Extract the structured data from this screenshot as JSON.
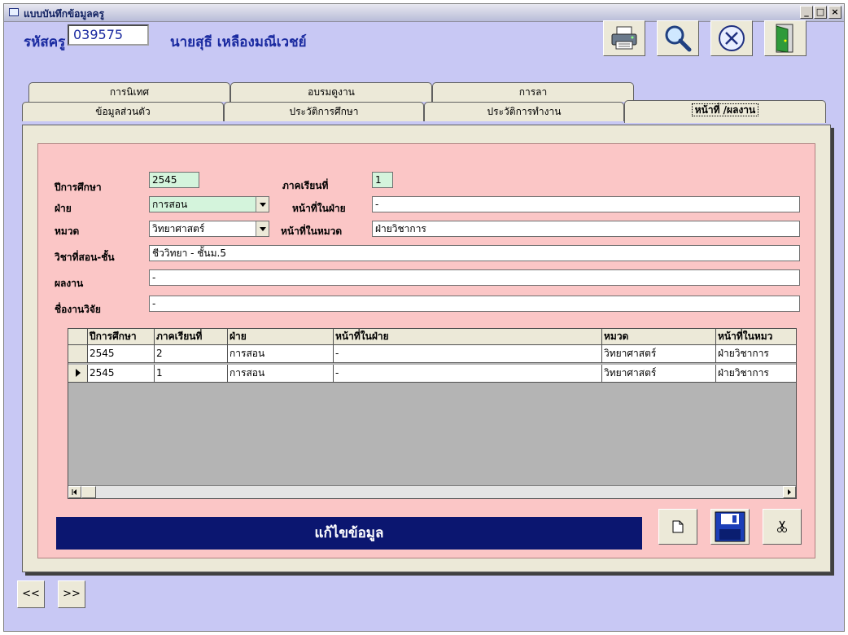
{
  "window": {
    "title": "แบบบันทึกข้อมูลครู"
  },
  "header": {
    "code_label": "รหัสครู",
    "code_value": "039575",
    "teacher_name": "นายสุธี เหลืองมณีเวชย์"
  },
  "tabs_back": [
    "การนิเทศ",
    "อบรมดูงาน",
    "การลา"
  ],
  "tabs_front": [
    "ข้อมูลส่วนตัว",
    "ประวัติการศึกษา",
    "ประวัติการทำงาน",
    "หน้าที่ /ผลงาน"
  ],
  "form": {
    "year_label": "ปีการศึกษา",
    "year_value": "2545",
    "term_label": "ภาคเรียนที่",
    "term_value": "1",
    "dept_label": "ฝ่าย",
    "dept_value": "การสอน",
    "dept_duty_label": "หน้าที่ในฝ่าย",
    "dept_duty_value": "-",
    "group_label": "หมวด",
    "group_value": "วิทยาศาสตร์",
    "group_duty_label": "หน้าที่ในหมวด",
    "group_duty_value": "ฝ่ายวิชาการ",
    "subject_label": "วิชาที่สอน-ชั้น",
    "subject_value": "ชีววิทยา - ชั้นม.5",
    "work_label": "ผลงาน",
    "work_value": "-",
    "research_label": "ชื่องานวิจัย",
    "research_value": "-"
  },
  "grid": {
    "columns": [
      "ปีการศึกษา",
      "ภาคเรียนที่",
      "ฝ่าย",
      "หน้าที่ในฝ่าย",
      "หมวด",
      "หน้าที่ในหมว"
    ],
    "rows": [
      [
        "2545",
        "2",
        "การสอน",
        "-",
        "วิทยาศาสตร์",
        "ฝ่ายวิชาการ"
      ],
      [
        "2545",
        "1",
        "การสอน",
        "-",
        "วิทยาศาสตร์",
        "ฝ่ายวิชาการ"
      ]
    ]
  },
  "status": {
    "text": "แก้ไขข้อมูล"
  },
  "nav": {
    "prev": "<<",
    "next": ">>"
  },
  "colors": {
    "status_bg": "#0b1670",
    "form_bg": "#fbc6c6",
    "window_bg": "#c8c8f4"
  }
}
